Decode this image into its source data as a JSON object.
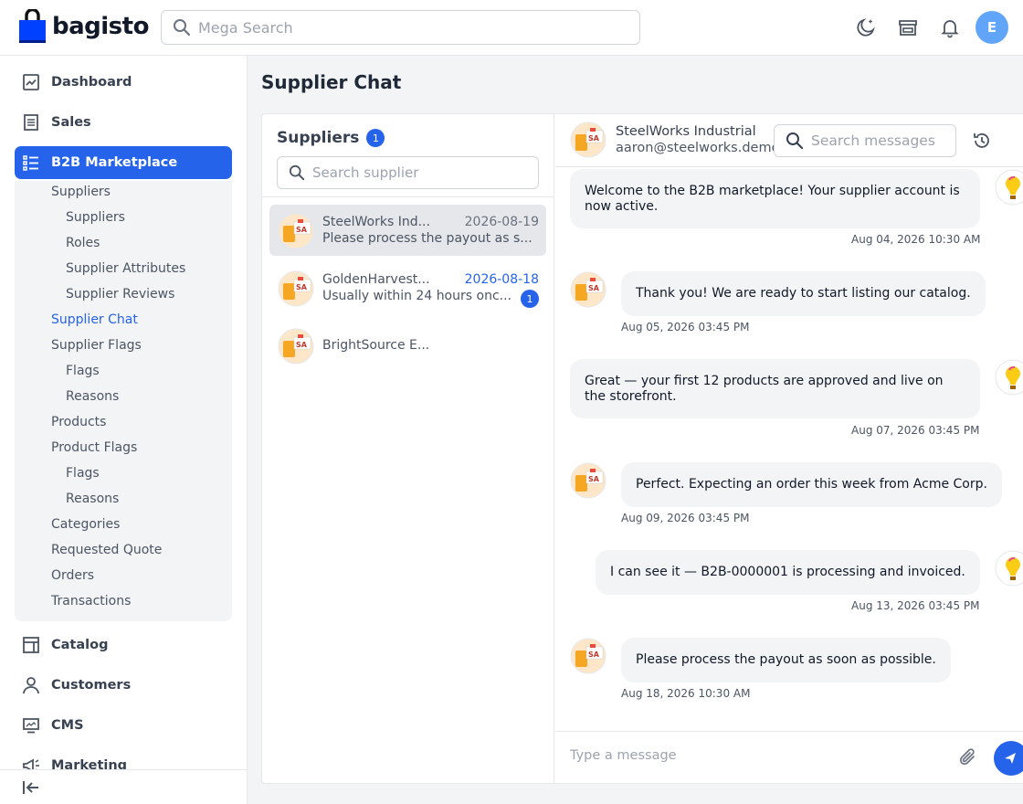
{
  "brand": {
    "name": "bagisto"
  },
  "header": {
    "search_placeholder": "Mega Search",
    "icons": [
      "moon-sparkle-icon",
      "storefront-icon",
      "bell-icon"
    ],
    "avatar_initial": "E"
  },
  "sidebar": {
    "items": [
      {
        "label": "Dashboard",
        "icon": "dashboard-icon"
      },
      {
        "label": "Sales",
        "icon": "receipt-icon"
      },
      {
        "label": "B2B Marketplace",
        "icon": "list-icon",
        "active": true
      },
      {
        "label": "Catalog",
        "icon": "catalog-icon"
      },
      {
        "label": "Customers",
        "icon": "user-icon"
      },
      {
        "label": "CMS",
        "icon": "monitor-icon"
      },
      {
        "label": "Marketing",
        "icon": "megaphone-icon"
      }
    ],
    "submenu": [
      {
        "label": "Suppliers",
        "level": 1
      },
      {
        "label": "Suppliers",
        "level": 2
      },
      {
        "label": "Roles",
        "level": 2
      },
      {
        "label": "Supplier Attributes",
        "level": 2
      },
      {
        "label": "Supplier Reviews",
        "level": 2
      },
      {
        "label": "Supplier Chat",
        "level": 1,
        "current": true
      },
      {
        "label": "Supplier Flags",
        "level": 1
      },
      {
        "label": "Flags",
        "level": 2
      },
      {
        "label": "Reasons",
        "level": 2
      },
      {
        "label": "Products",
        "level": 1
      },
      {
        "label": "Product Flags",
        "level": 1
      },
      {
        "label": "Flags",
        "level": 2
      },
      {
        "label": "Reasons",
        "level": 2
      },
      {
        "label": "Categories",
        "level": 1
      },
      {
        "label": "Requested Quote",
        "level": 1
      },
      {
        "label": "Orders",
        "level": 1
      },
      {
        "label": "Transactions",
        "level": 1
      }
    ]
  },
  "page": {
    "title": "Supplier Chat"
  },
  "suppliers": {
    "heading": "Suppliers",
    "count": "1",
    "search_placeholder": "Search supplier",
    "list": [
      {
        "name": "SteelWorks Ind...",
        "date": "2026-08-19",
        "preview": "Please process the payout as s...",
        "selected": true,
        "unread": ""
      },
      {
        "name": "GoldenHarvest...",
        "date": "2026-08-18",
        "preview": "Usually within 24 hours onc...",
        "selected": false,
        "unread": "1"
      },
      {
        "name": "BrightSource E...",
        "date": "",
        "preview": "",
        "selected": false,
        "unread": ""
      }
    ]
  },
  "conversation": {
    "name": "SteelWorks Industrial",
    "email": "aaron@steelworks.demo",
    "search_placeholder": "Search messages",
    "messages": [
      {
        "from": "admin",
        "text": "Welcome to the B2B marketplace! Your supplier account is now active.",
        "time": "Aug 04, 2026 10:30 AM"
      },
      {
        "from": "supplier",
        "text": "Thank you! We are ready to start listing our catalog.",
        "time": "Aug 05, 2026 03:45 PM"
      },
      {
        "from": "admin",
        "text": "Great — your first 12 products are approved and live on the storefront.",
        "time": "Aug 07, 2026 03:45 PM"
      },
      {
        "from": "supplier",
        "text": "Perfect. Expecting an order this week from Acme Corp.",
        "time": "Aug 09, 2026 03:45 PM"
      },
      {
        "from": "admin",
        "text": "I can see it — B2B-0000001 is processing and invoiced.",
        "time": "Aug 13, 2026 03:45 PM"
      },
      {
        "from": "supplier",
        "text": "Please process the payout as soon as possible.",
        "time": "Aug 18, 2026 10:30 AM"
      }
    ],
    "composer_placeholder": "Type a message"
  }
}
